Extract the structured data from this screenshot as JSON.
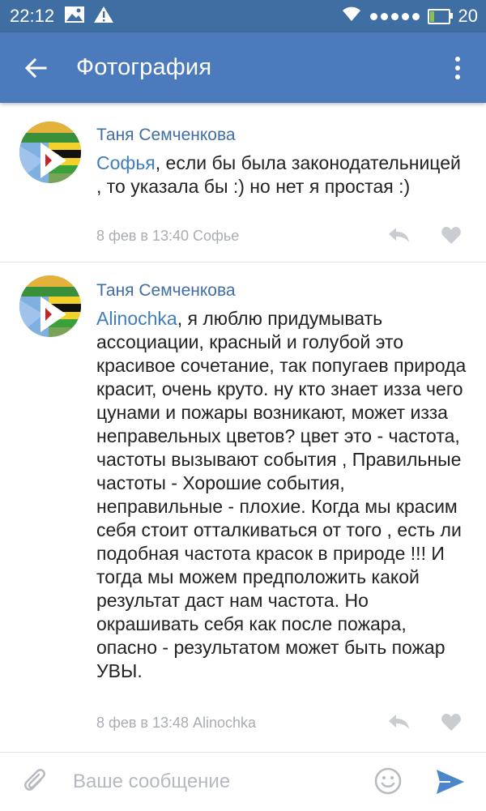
{
  "status_bar": {
    "time": "22:12",
    "battery": "20"
  },
  "app_bar": {
    "title": "Фотография"
  },
  "comments": [
    {
      "author": "Таня Семченкова",
      "mention": "Софья",
      "text": ", если бы была законодательницей , то указала бы :) но нет я простая :)",
      "meta": "8 фев в 13:40 Софье"
    },
    {
      "author": "Таня Семченкова",
      "mention": "Alinochka",
      "text": ", я люблю придумывать ассоциации, красный и голубой это красивое сочетание, так попугаев природа красит, очень круто. ну кто знает изза чего цунами и пожары возникают, может изза неправельных цветов? цвет это - частота, частоты вызывают события , Правильные частоты - Хорошие события, неправильные - плохие. Когда мы красим себя стоит отталкиваться от того , есть ли подобная частота красок в природе !!! И тогда мы можем предположить какой результат даст нам частота. Но окрашивать себя как после пожара, опасно - результатом может быть пожар УВЫ.",
      "meta": "8 фев в 13:48 Alinochka"
    }
  ],
  "composer": {
    "placeholder": "Ваше сообщение"
  },
  "colors": {
    "status_bar": "#3f6ea2",
    "app_bar": "#4b7bbd",
    "link": "#3f7dbd",
    "meta": "#a8adb3",
    "send": "#4a86c8"
  }
}
